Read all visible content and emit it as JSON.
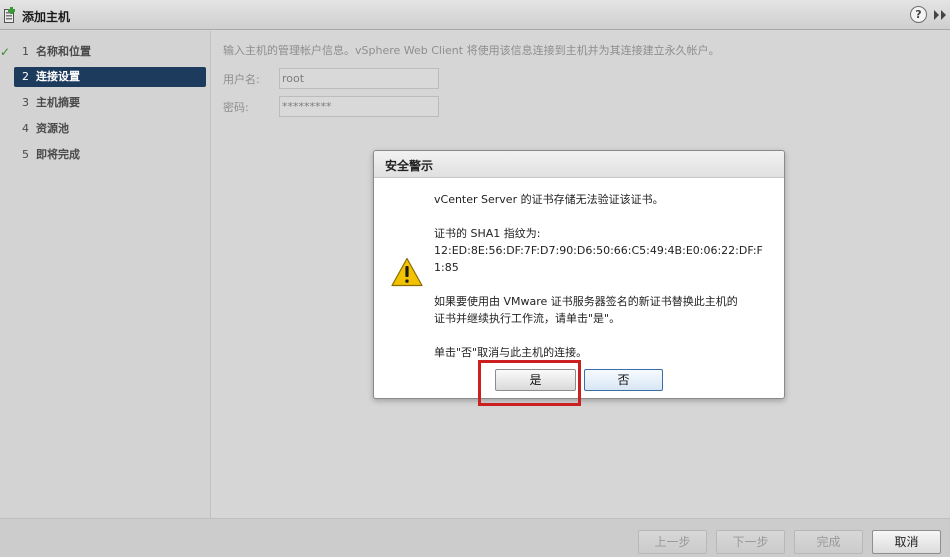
{
  "window": {
    "title": "添加主机",
    "help_label": "?",
    "icons": {
      "app": "add-host-icon",
      "help": "help-icon",
      "forward": "forward-icon"
    }
  },
  "sidebar": {
    "steps": [
      {
        "num": "1",
        "label": "名称和位置",
        "state": "completed"
      },
      {
        "num": "2",
        "label": "连接设置",
        "state": "active"
      },
      {
        "num": "3",
        "label": "主机摘要",
        "state": "pending"
      },
      {
        "num": "4",
        "label": "资源池",
        "state": "pending"
      },
      {
        "num": "5",
        "label": "即将完成",
        "state": "pending"
      }
    ],
    "check_glyph": "✓"
  },
  "main": {
    "intro": "输入主机的管理帐户信息。vSphere Web Client 将使用该信息连接到主机并为其连接建立永久帐户。",
    "username_label": "用户名:",
    "username_value": "root",
    "password_label": "密码:",
    "password_value": "*********"
  },
  "dialog": {
    "title": "安全警示",
    "line1": "vCenter Server 的证书存储无法验证该证书。",
    "line2": "证书的 SHA1 指纹为:",
    "line3": "12:ED:8E:56:DF:7F:D7:90:D6:50:66:C5:49:4B:E0:06:22:DF:F",
    "line4": "1:85",
    "line5": "如果要使用由 VMware 证书服务器签名的新证书替换此主机的",
    "line6": "证书并继续执行工作流，请单击\"是\"。",
    "line7": "单击\"否\"取消与此主机的连接。",
    "yes_label": "是",
    "no_label": "否",
    "icon": "warning-icon"
  },
  "footer": {
    "back_label": "上一步",
    "next_label": "下一步",
    "finish_label": "完成",
    "cancel_label": "取消"
  },
  "colors": {
    "active_step": "#1d3b5c",
    "highlight": "#cc1f1f",
    "warning": "#f2c200"
  }
}
